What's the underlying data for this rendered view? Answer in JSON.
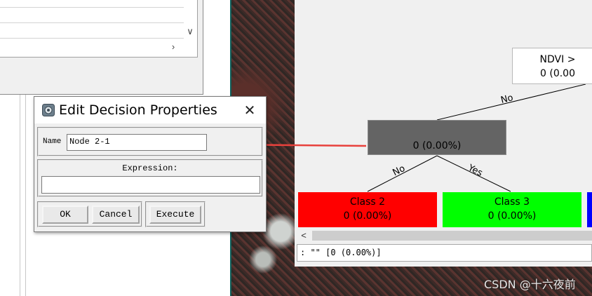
{
  "background_list": {
    "scroll_down_symbol": "∨",
    "scroll_right_symbol": "›"
  },
  "dialog": {
    "title": "Edit Decision Properties",
    "close_symbol": "✕",
    "name_label": "Name",
    "name_value": "Node 2-1",
    "expression_label": "Expression:",
    "expression_value": "",
    "ok_label": "OK",
    "cancel_label": "Cancel",
    "execute_label": "Execute"
  },
  "tree": {
    "root": {
      "line1": "NDVI >",
      "line2": "0 (0.00"
    },
    "decision_node": {
      "text": "0 (0.00%)",
      "color": "#646464"
    },
    "edges": {
      "no_top": "No",
      "no_left": "No",
      "yes_right": "Yes"
    },
    "class2": {
      "name": "Class 2",
      "value": "0 (0.00%)",
      "color": "#ff0000"
    },
    "class3": {
      "name": "Class 3",
      "value": "0 (0.00%)",
      "color": "#00ff00"
    },
    "class_blue_color": "#0000ff",
    "scroll_left_symbol": "<",
    "status_text": ": \"\" [0  (0.00%)]"
  },
  "annotation": {
    "arrow_color": "#e8413c"
  },
  "watermark": "CSDN @十六夜前"
}
